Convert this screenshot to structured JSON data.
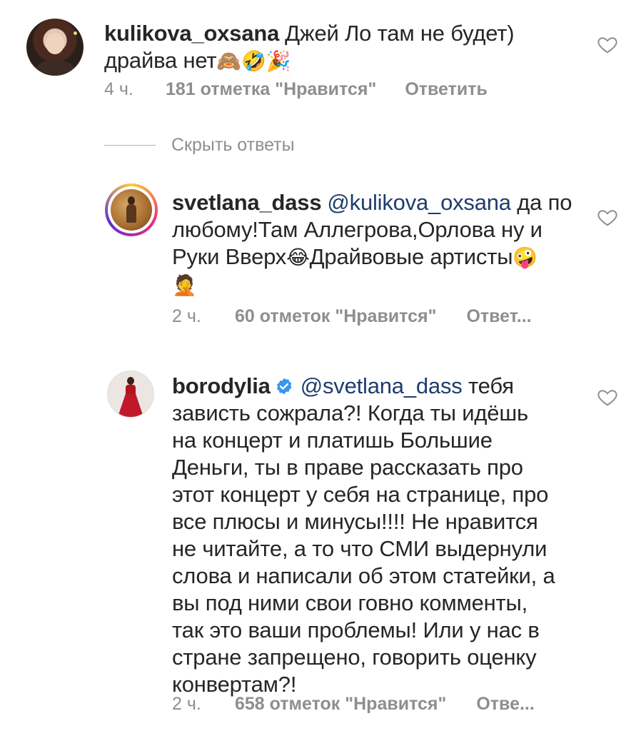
{
  "colors": {
    "text": "#262626",
    "meta": "#8e8e8e",
    "mention": "#1f3d6d",
    "verified": "#3897f0"
  },
  "comments": [
    {
      "username": "kulikova_oxsana",
      "text_line1": "Джей Ло там не будет)",
      "text_line2": "драйва нет",
      "emojis": "🙈🤣🎉",
      "time": "4 ч.",
      "likes": "181 отметка \"Нравится\"",
      "reply": "Ответить"
    },
    {
      "username": "svetlana_dass",
      "mention": "@kulikova_oxsana",
      "text_a": "да по",
      "text_b": "любому!Там Аллегрова,Орлова ну и",
      "text_c": "Руки Вверх",
      "emoji_c": "😂",
      "text_d": "Драйвовые артисты",
      "emoji_d": "🤪",
      "emoji_e": "🤦",
      "time": "2 ч.",
      "likes": "60 отметок \"Нравится\"",
      "reply": "Ответ..."
    },
    {
      "username": "borodylia",
      "mention": "@svetlana_dass",
      "lines": [
        "тебя",
        "зависть сожрала?! Когда ты идёшь",
        "на концерт и платишь Большие",
        "Деньги, ты в праве рассказать про",
        "этот концерт у себя на странице, про",
        "все плюсы и минусы!!!! Не нравится",
        "не читайте, а то что СМИ выдернули",
        "слова и написали об этом статейки, а",
        "вы под ними свои говно комменты,",
        "так это ваши проблемы! Или у нас в",
        "стране запрещено, говорить оценку",
        "конвертам?!"
      ],
      "time": "2 ч.",
      "likes": "658 отметок \"Нравится\"",
      "reply": "Отве..."
    }
  ],
  "hide_replies": "Скрыть ответы",
  "icons": {
    "like": "heart-outline-icon",
    "verified": "verified-badge-icon"
  }
}
